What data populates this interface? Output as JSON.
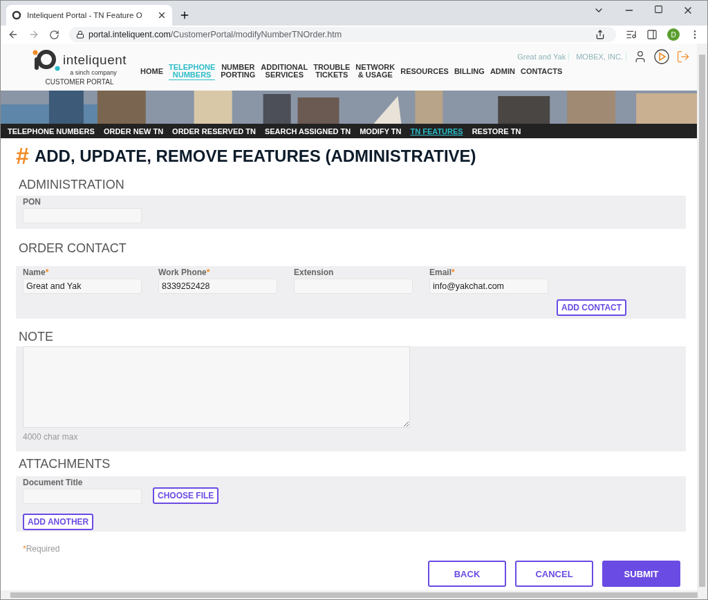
{
  "browser": {
    "tab_title": "Inteliquent Portal - TN Feature O",
    "url_host": "portal.inteliquent.com",
    "url_path": "/CustomerPortal/modifyNumberTNOrder.htm",
    "profile_initial": "D"
  },
  "header": {
    "logo_name": "inteliquent",
    "logo_tagline": "a sinch company",
    "subtitle": "CUSTOMER PORTAL",
    "user_info": [
      "Great and Yak",
      "MOBEX, INC."
    ],
    "nav": [
      {
        "lines": [
          "HOME"
        ],
        "selected": false
      },
      {
        "lines": [
          "TELEPHONE",
          "NUMBERS"
        ],
        "selected": true
      },
      {
        "lines": [
          "NUMBER",
          "PORTING"
        ],
        "selected": false
      },
      {
        "lines": [
          "ADDITIONAL",
          "SERVICES"
        ],
        "selected": false
      },
      {
        "lines": [
          "TROUBLE",
          "TICKETS"
        ],
        "selected": false
      },
      {
        "lines": [
          "NETWORK",
          "& USAGE"
        ],
        "selected": false
      },
      {
        "lines": [
          "RESOURCES"
        ],
        "selected": false
      },
      {
        "lines": [
          "BILLING"
        ],
        "selected": false
      },
      {
        "lines": [
          "ADMIN"
        ],
        "selected": false
      },
      {
        "lines": [
          "CONTACTS"
        ],
        "selected": false
      }
    ]
  },
  "subnav": [
    {
      "label": "TELEPHONE NUMBERS",
      "selected": false
    },
    {
      "label": "ORDER NEW TN",
      "selected": false
    },
    {
      "label": "ORDER RESERVED TN",
      "selected": false
    },
    {
      "label": "SEARCH ASSIGNED TN",
      "selected": false
    },
    {
      "label": "MODIFY TN",
      "selected": false
    },
    {
      "label": "TN FEATURES",
      "selected": true
    },
    {
      "label": "RESTORE TN",
      "selected": false
    }
  ],
  "page_title": {
    "mark": "#",
    "text": "ADD, UPDATE, REMOVE FEATURES (ADMINISTRATIVE)"
  },
  "required_mark": "*",
  "administration": {
    "title": "ADMINISTRATION",
    "fields": [
      {
        "label": "PON",
        "required": false
      }
    ]
  },
  "order_contact": {
    "title": "ORDER CONTACT",
    "fields": [
      {
        "label": "Name",
        "required": true,
        "value": "Great and Yak"
      },
      {
        "label": "Work Phone",
        "required": true,
        "value": "8339252428"
      },
      {
        "label": "Extension",
        "required": false
      },
      {
        "label": "Email",
        "required": true,
        "value": "info@yakchat.com"
      }
    ],
    "button": "ADD CONTACT"
  },
  "note": {
    "title": "NOTE",
    "hint": "4000 char max"
  },
  "attachments": {
    "title": "ATTACHMENTS",
    "field_label": "Document Title",
    "choose_button": "CHOOSE FILE",
    "add_button": "ADD ANOTHER"
  },
  "required_note": "Required",
  "actions": [
    {
      "label": "BACK",
      "primary": false
    },
    {
      "label": "CANCEL",
      "primary": false
    },
    {
      "label": "SUBMIT",
      "primary": true
    }
  ]
}
